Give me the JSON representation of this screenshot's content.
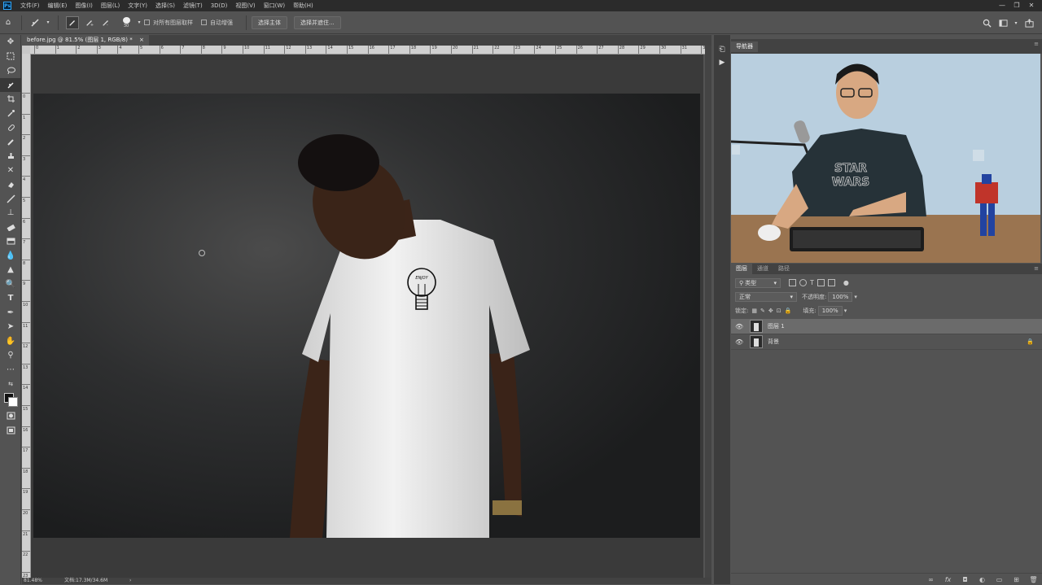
{
  "menubar": {
    "items": [
      "文件(F)",
      "编辑(E)",
      "图像(I)",
      "图层(L)",
      "文字(Y)",
      "选择(S)",
      "滤镜(T)",
      "3D(D)",
      "视图(V)",
      "窗口(W)",
      "帮助(H)"
    ],
    "window_controls": [
      "—",
      "❐",
      "✕"
    ]
  },
  "options_bar": {
    "brush_size": "30",
    "sample_all_layers": "对所有图层取样",
    "auto_enhance": "自动增强",
    "select_subject": "选择主体",
    "select_and_mask": "选择并遮住..."
  },
  "document": {
    "tab_title": "before.jpg @ 81.5% (图层 1, RGB/8) *",
    "close_glyph": "×",
    "zoom": "81.48%",
    "doc_info": "文档:17.3M/34.6M",
    "status_arrow": "›"
  },
  "ruler": {
    "h_labels": [
      "0",
      "1",
      "2",
      "3",
      "4",
      "5",
      "6",
      "7",
      "8",
      "9",
      "10",
      "11",
      "12",
      "13",
      "14",
      "15",
      "16",
      "17",
      "18",
      "19",
      "20",
      "21",
      "22",
      "23",
      "24",
      "25",
      "26",
      "27",
      "28",
      "29",
      "30",
      "31",
      "32"
    ],
    "v_labels": [
      "0",
      "1",
      "2",
      "3",
      "4",
      "5",
      "6",
      "7",
      "8",
      "9",
      "10",
      "11",
      "12",
      "13",
      "14",
      "15",
      "16",
      "17",
      "18",
      "19",
      "20",
      "21",
      "22",
      "23",
      "24",
      "25"
    ]
  },
  "shirt_graphic_text": "ENJOY",
  "navigator": {
    "tab": "导航器",
    "menu_glyph": "≡"
  },
  "video": {
    "shirt_text_line1": "STAR",
    "shirt_text_line2": "WARS"
  },
  "layers_panel": {
    "tabs": [
      "图层",
      "通道",
      "路径"
    ],
    "menu_glyph": "≡",
    "filter_label": "类型",
    "blend_mode": "正常",
    "opacity_label": "不透明度:",
    "opacity_value": "100%",
    "lock_label": "锁定:",
    "fill_label": "填充:",
    "fill_value": "100%",
    "layers": [
      {
        "name": "图层 1",
        "selected": true,
        "locked": false
      },
      {
        "name": "背景",
        "selected": false,
        "locked": true
      }
    ]
  },
  "colors": {
    "accent": "#31a8ff",
    "ui_dark": "#2b2b2b",
    "ui_mid": "#535353"
  }
}
